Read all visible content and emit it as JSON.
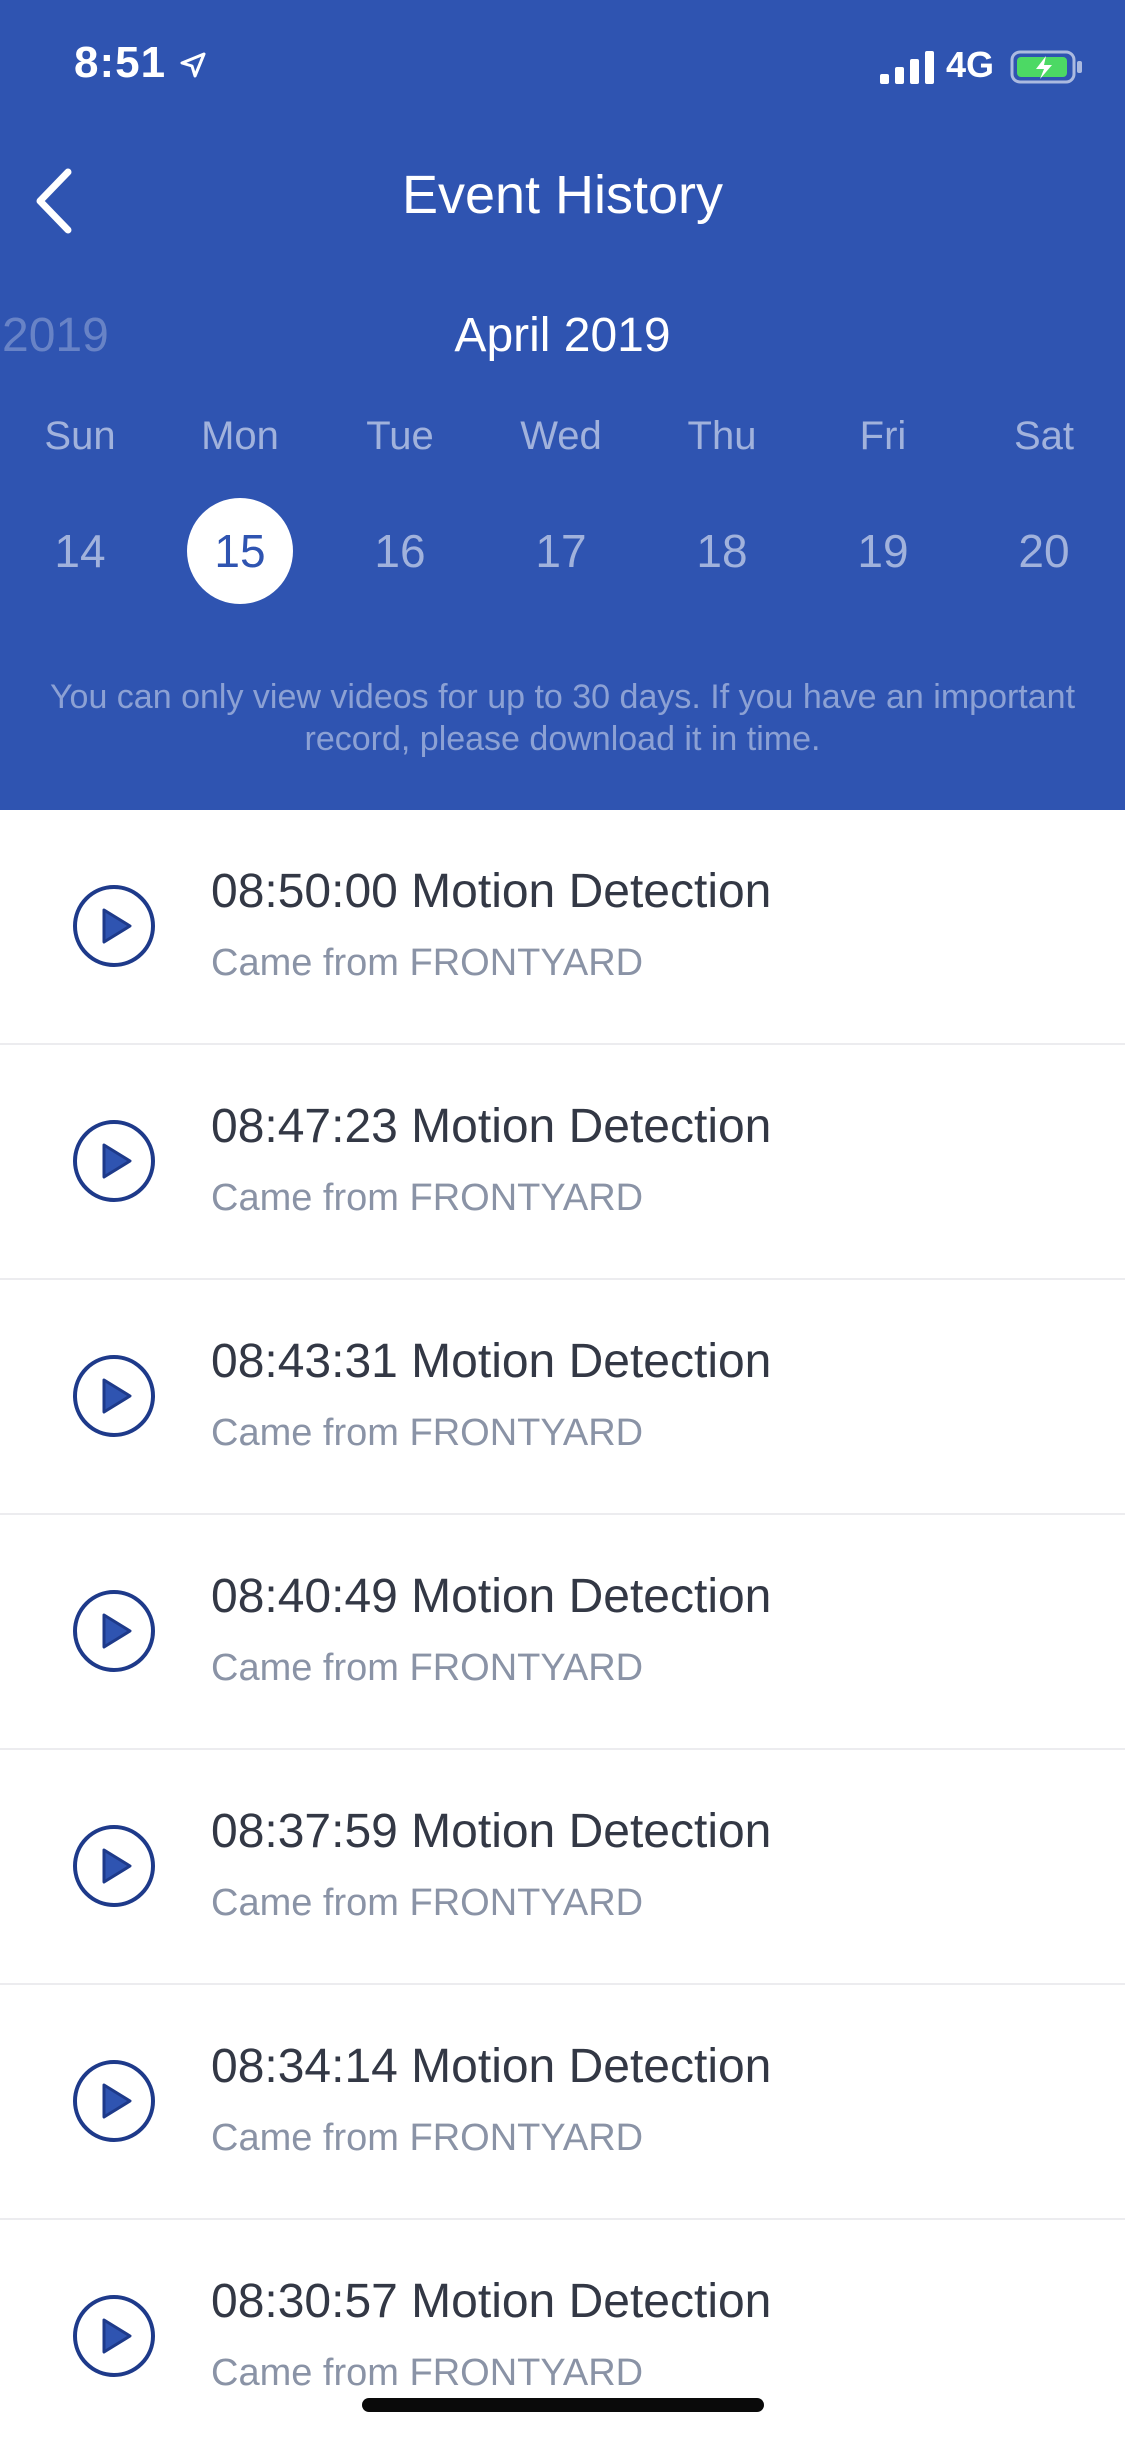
{
  "status_bar": {
    "time": "8:51",
    "network": "4G"
  },
  "nav": {
    "title": "Event History"
  },
  "calendar": {
    "prev_year": "2019",
    "month_title": "April 2019",
    "weekdays": [
      "Sun",
      "Mon",
      "Tue",
      "Wed",
      "Thu",
      "Fri",
      "Sat"
    ],
    "days": [
      "14",
      "15",
      "16",
      "17",
      "18",
      "19",
      "20"
    ],
    "selected_day": "15"
  },
  "notice": "You can only view videos for up to 30 days. If you have an important record, please download it in time.",
  "events": [
    {
      "title": "08:50:00 Motion Detection",
      "source": "Came from FRONTYARD"
    },
    {
      "title": "08:47:23 Motion Detection",
      "source": "Came from FRONTYARD"
    },
    {
      "title": "08:43:31 Motion Detection",
      "source": "Came from FRONTYARD"
    },
    {
      "title": "08:40:49 Motion Detection",
      "source": "Came from FRONTYARD"
    },
    {
      "title": "08:37:59 Motion Detection",
      "source": "Came from FRONTYARD"
    },
    {
      "title": "08:34:14 Motion Detection",
      "source": "Came from FRONTYARD"
    },
    {
      "title": "08:30:57 Motion Detection",
      "source": "Came from FRONTYARD"
    }
  ],
  "colors": {
    "header_bg": "#2f54b1",
    "play_icon_ring": "#1e3a8a",
    "play_icon_fill": "#2f54b1"
  }
}
